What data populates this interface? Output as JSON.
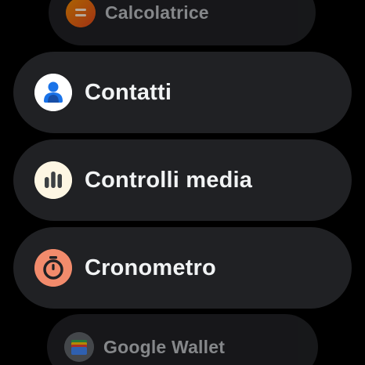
{
  "apps": [
    {
      "label": "Calcolatrice",
      "icon": "calculator-icon",
      "icon_bg": "#e8710a"
    },
    {
      "label": "Contatti",
      "icon": "contact-person-icon",
      "icon_bg": "#ffffff"
    },
    {
      "label": "Controlli media",
      "icon": "media-equalizer-icon",
      "icon_bg": "#fdf6e3"
    },
    {
      "label": "Cronometro",
      "icon": "stopwatch-icon",
      "icon_bg": "#f28b6c"
    },
    {
      "label": "Google Wallet",
      "icon": "wallet-icon",
      "icon_bg": "#5f6368"
    }
  ],
  "colors": {
    "background": "#000000",
    "chip": "#202124",
    "text": "#f1f3f4"
  }
}
